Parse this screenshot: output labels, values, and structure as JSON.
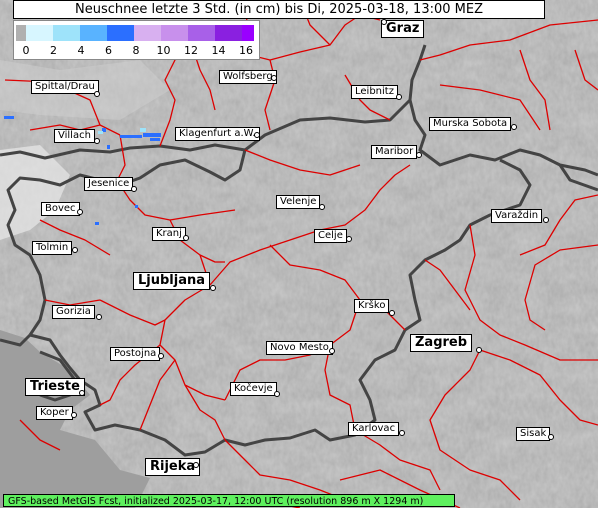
{
  "title": "Neuschnee letzte 3 Std. (in cm) bis Di, 2025-03-18, 13:00 MEZ",
  "legend": {
    "ticks": [
      "0",
      "2",
      "4",
      "6",
      "8",
      "10",
      "12",
      "14",
      "16"
    ],
    "colors": [
      "#b0b0b0",
      "#d7f6ff",
      "#9ee3fa",
      "#59b3ff",
      "#2b6fff",
      "#d8b0f0",
      "#c890ec",
      "#a860e8",
      "#8a20e0",
      "#9a00ff"
    ]
  },
  "footer": "GFS-based MetGIS Fcst, initialized 2025-03-17, 12:00 UTC  (resolution 896 m X 1294 m)",
  "cities": [
    {
      "name": "Graz",
      "big": true
    },
    {
      "name": "Spittal/Drau"
    },
    {
      "name": "Wolfsberg"
    },
    {
      "name": "Leibnitz"
    },
    {
      "name": "Villach"
    },
    {
      "name": "Klagenfurt a.W."
    },
    {
      "name": "Murska Sobota"
    },
    {
      "name": "Maribor"
    },
    {
      "name": "Jesenice"
    },
    {
      "name": "Velenje"
    },
    {
      "name": "Bovec"
    },
    {
      "name": "Varaždin"
    },
    {
      "name": "Kranj"
    },
    {
      "name": "Celje"
    },
    {
      "name": "Tolmin"
    },
    {
      "name": "Ljubljana",
      "big": true
    },
    {
      "name": "Gorizia"
    },
    {
      "name": "Krško"
    },
    {
      "name": "Postojna"
    },
    {
      "name": "Novo Mesto"
    },
    {
      "name": "Zagreb",
      "big": true
    },
    {
      "name": "Trieste",
      "big": true
    },
    {
      "name": "Kočevje"
    },
    {
      "name": "Koper"
    },
    {
      "name": "Karlovac"
    },
    {
      "name": "Sisak"
    },
    {
      "name": "Rijeka",
      "big": true
    }
  ]
}
